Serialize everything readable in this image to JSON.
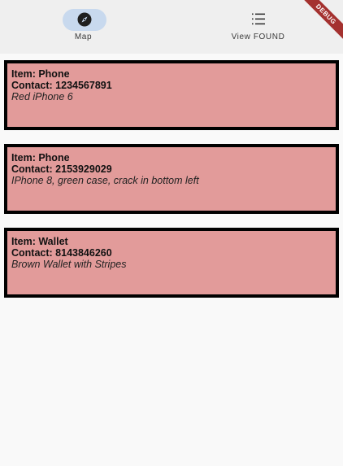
{
  "nav": {
    "items": [
      {
        "label": "Map",
        "icon": "compass-icon",
        "selected": true
      },
      {
        "label": "View FOUND",
        "icon": "list-icon",
        "selected": false
      }
    ],
    "indicator_color": "#c8d9ee"
  },
  "debug_banner": "DEBUG",
  "cards": [
    {
      "item": "Item: Phone",
      "contact": "Contact: 1234567891",
      "description": "Red iPhone 6"
    },
    {
      "item": "Item: Phone",
      "contact": "Contact: 2153929029",
      "description": "IPhone 8, green case, crack in bottom left"
    },
    {
      "item": "Item: Wallet",
      "contact": "Contact: 8143846260",
      "description": "Brown Wallet with Stripes"
    }
  ],
  "colors": {
    "card_background": "#e29b9a",
    "card_border": "#000000",
    "nav_background": "#efefef",
    "page_background": "#f9f9f9",
    "debug_ribbon": "#a4312f"
  }
}
